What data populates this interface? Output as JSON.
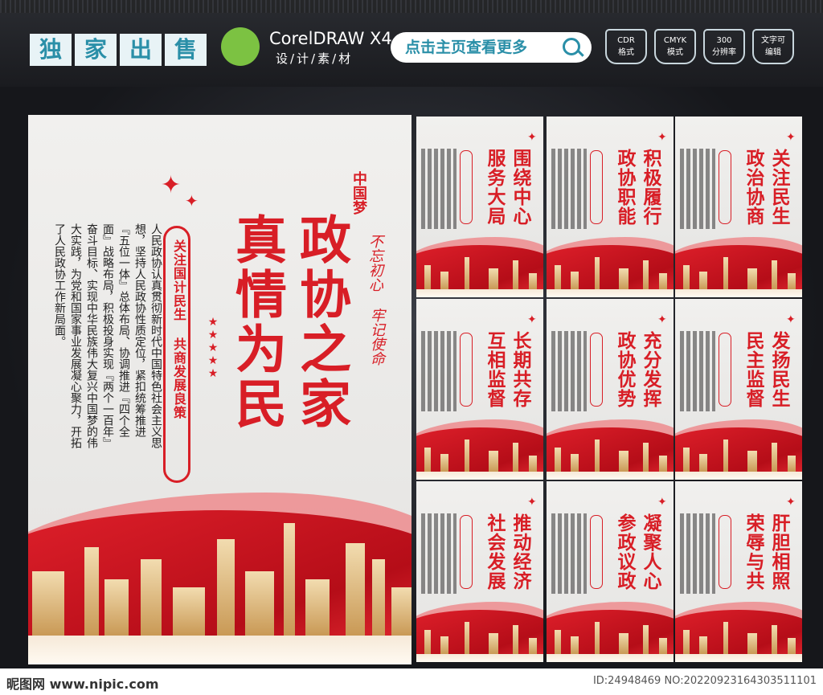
{
  "header": {
    "badges": [
      "独",
      "家",
      "出",
      "售"
    ],
    "software": "CorelDRAW X4",
    "software_sub": "设/计/素/材",
    "search_label": "点击主页查看更多",
    "specs": [
      {
        "top": "CDR",
        "bottom": "格式"
      },
      {
        "top": "CMYK",
        "bottom": "模式"
      },
      {
        "top": "300",
        "bottom": "分辨率"
      },
      {
        "top": "文字可",
        "bottom": "编辑"
      }
    ]
  },
  "main_poster": {
    "title_col1": "政协之家",
    "title_col2": "真情为民",
    "banner": "关注国计民生 共商发展良策",
    "seal": "中国梦",
    "slogan_col1": "不忘初心",
    "slogan_col2": "牢记使命",
    "body_cols": [
      "人民政协认真贯彻新时代中国特色社会主义思",
      "想，坚持人民政协性质定位，紧扣统筹推进",
      "『五位一体』总体布局、协调推进『四个全",
      "面』战略布局，积极投身实现『两个一百年』",
      "奋斗目标、实现中华民族伟大复兴中国梦的伟",
      "大实践，为党和国家事业发展凝心聚力，开拓",
      "了人民政协工作新局面。"
    ]
  },
  "small_posters": [
    {
      "col1": "围绕中心",
      "col2": "服务大局"
    },
    {
      "col1": "积极履行",
      "col2": "政协职能"
    },
    {
      "col1": "关注民生",
      "col2": "政治协商"
    },
    {
      "col1": "长期共存",
      "col2": "互相监督"
    },
    {
      "col1": "充分发挥",
      "col2": "政协优势"
    },
    {
      "col1": "发扬民生",
      "col2": "民主监督"
    },
    {
      "col1": "推动经济",
      "col2": "社会发展"
    },
    {
      "col1": "凝聚人心",
      "col2": "参政议政"
    },
    {
      "col1": "肝胆相照",
      "col2": "荣辱与共"
    }
  ],
  "footer": {
    "site": "昵图网 www.nipic.com",
    "id": "ID:24948469 NO:20220923164303511101"
  }
}
